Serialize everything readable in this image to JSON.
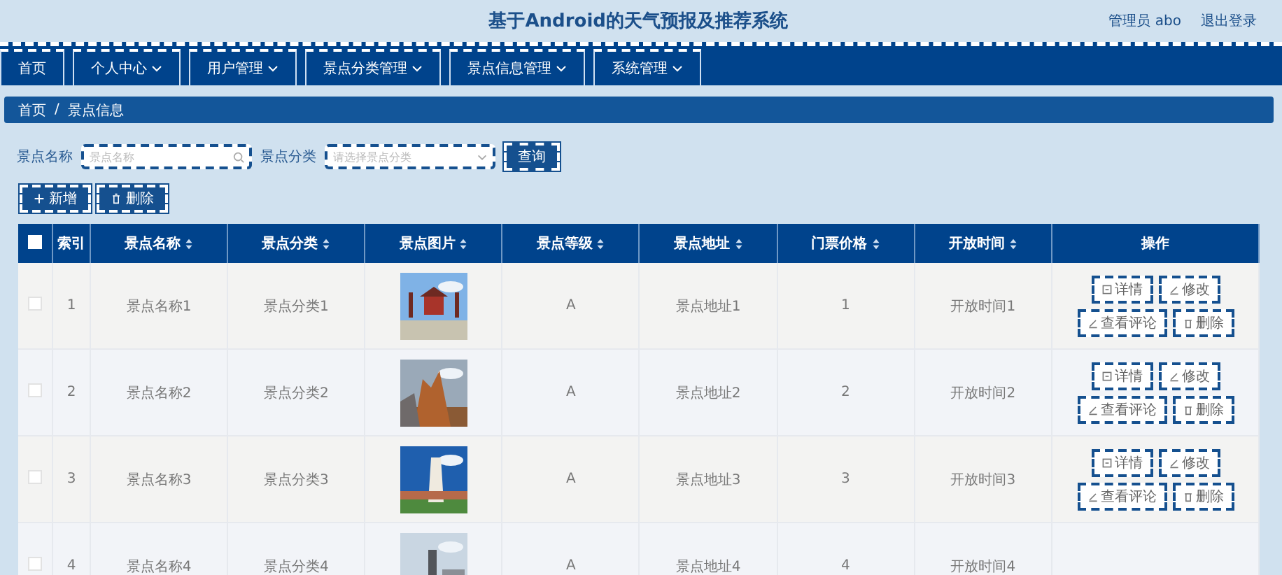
{
  "header": {
    "title": "基于Android的天气预报及推荐系统",
    "user": "管理员 abo",
    "logout": "退出登录"
  },
  "nav": [
    {
      "label": "首页",
      "dropdown": false
    },
    {
      "label": "个人中心",
      "dropdown": true
    },
    {
      "label": "用户管理",
      "dropdown": true
    },
    {
      "label": "景点分类管理",
      "dropdown": true
    },
    {
      "label": "景点信息管理",
      "dropdown": true
    },
    {
      "label": "系统管理",
      "dropdown": true
    }
  ],
  "breadcrumb": [
    "首页",
    "/",
    "景点信息"
  ],
  "search": {
    "name_label": "景点名称",
    "name_placeholder": "景点名称",
    "category_label": "景点分类",
    "category_placeholder": "请选择景点分类",
    "query": "查询"
  },
  "actions": [
    {
      "label": "新增",
      "kind": "add"
    },
    {
      "label": "删除",
      "kind": "delete"
    }
  ],
  "table": {
    "select_all_checked": false,
    "columns": [
      {
        "label": "索引",
        "sortable": false
      },
      {
        "label": "景点名称",
        "sortable": true
      },
      {
        "label": "景点分类",
        "sortable": true
      },
      {
        "label": "景点图片",
        "sortable": true
      },
      {
        "label": "景点等级",
        "sortable": true
      },
      {
        "label": "景点地址",
        "sortable": true
      },
      {
        "label": "门票价格",
        "sortable": true
      },
      {
        "label": "开放时间",
        "sortable": true
      },
      {
        "label": "操作",
        "sortable": false
      }
    ],
    "rows": [
      {
        "checked": false,
        "cells": [
          "1",
          "景点名称1",
          "景点分类1",
          {
            "kind": "picture"
          },
          "A",
          "景点地址1",
          "1",
          "开放时间1"
        ],
        "buttons": [
          {
            "label": "详情",
            "kind": "detail"
          },
          {
            "label": "修改",
            "kind": "edit"
          },
          {
            "label": "查看评论",
            "kind": "edit"
          },
          {
            "label": "删除",
            "kind": "delete"
          }
        ]
      },
      {
        "checked": false,
        "cells": [
          "2",
          "景点名称2",
          "景点分类2",
          {
            "kind": "picture"
          },
          "A",
          "景点地址2",
          "2",
          "开放时间2"
        ],
        "buttons": [
          {
            "label": "详情",
            "kind": "detail"
          },
          {
            "label": "修改",
            "kind": "edit"
          },
          {
            "label": "查看评论",
            "kind": "edit"
          },
          {
            "label": "删除",
            "kind": "delete"
          }
        ]
      },
      {
        "checked": false,
        "cells": [
          "3",
          "景点名称3",
          "景点分类3",
          {
            "kind": "picture"
          },
          "A",
          "景点地址3",
          "3",
          "开放时间3"
        ],
        "buttons": [
          {
            "label": "详情",
            "kind": "detail"
          },
          {
            "label": "修改",
            "kind": "edit"
          },
          {
            "label": "查看评论",
            "kind": "edit"
          },
          {
            "label": "删除",
            "kind": "delete"
          }
        ]
      },
      {
        "checked": false,
        "cells": [
          "4",
          "景点名称4",
          "景点分类4",
          {
            "kind": "picture"
          },
          "A",
          "景点地址4",
          "4",
          "开放时间4"
        ],
        "buttons": []
      }
    ]
  }
}
